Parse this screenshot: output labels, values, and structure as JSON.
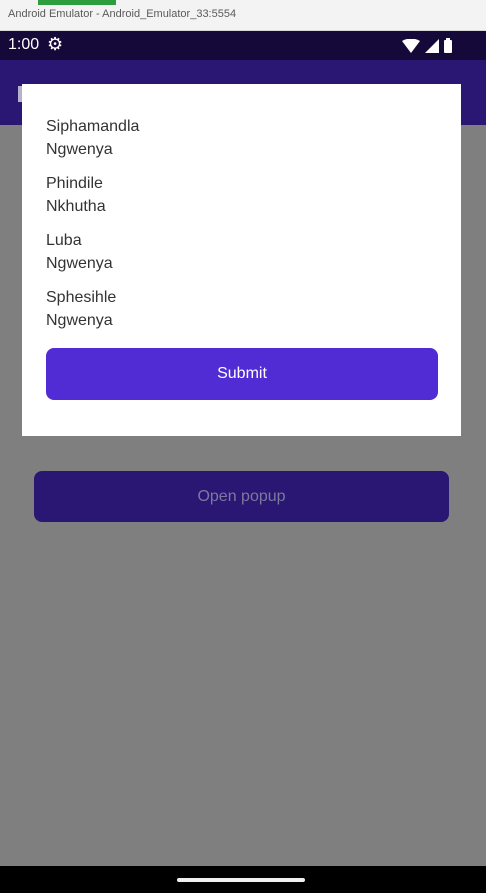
{
  "window": {
    "title": "Android Emulator - Android_Emulator_33:5554"
  },
  "status_bar": {
    "time": "1:00",
    "settings_icon": "gear-icon",
    "wifi_icon": "wifi-icon",
    "signal_icon": "signal-icon",
    "battery_icon": "battery-icon"
  },
  "main": {
    "open_popup_label": "Open popup"
  },
  "popup": {
    "people": [
      {
        "first": "Siphamandla",
        "last": "Ngwenya"
      },
      {
        "first": "Phindile",
        "last": "Nkhutha"
      },
      {
        "first": "Luba",
        "last": "Ngwenya"
      },
      {
        "first": "Sphesihle",
        "last": "Ngwenya"
      }
    ],
    "submit_label": "Submit"
  },
  "colors": {
    "status_bar": "#15093a",
    "app_bar": "#2a1673",
    "overlay": "#7f7f7f",
    "accent": "#512bd4",
    "popup_background": "#ffffff"
  }
}
